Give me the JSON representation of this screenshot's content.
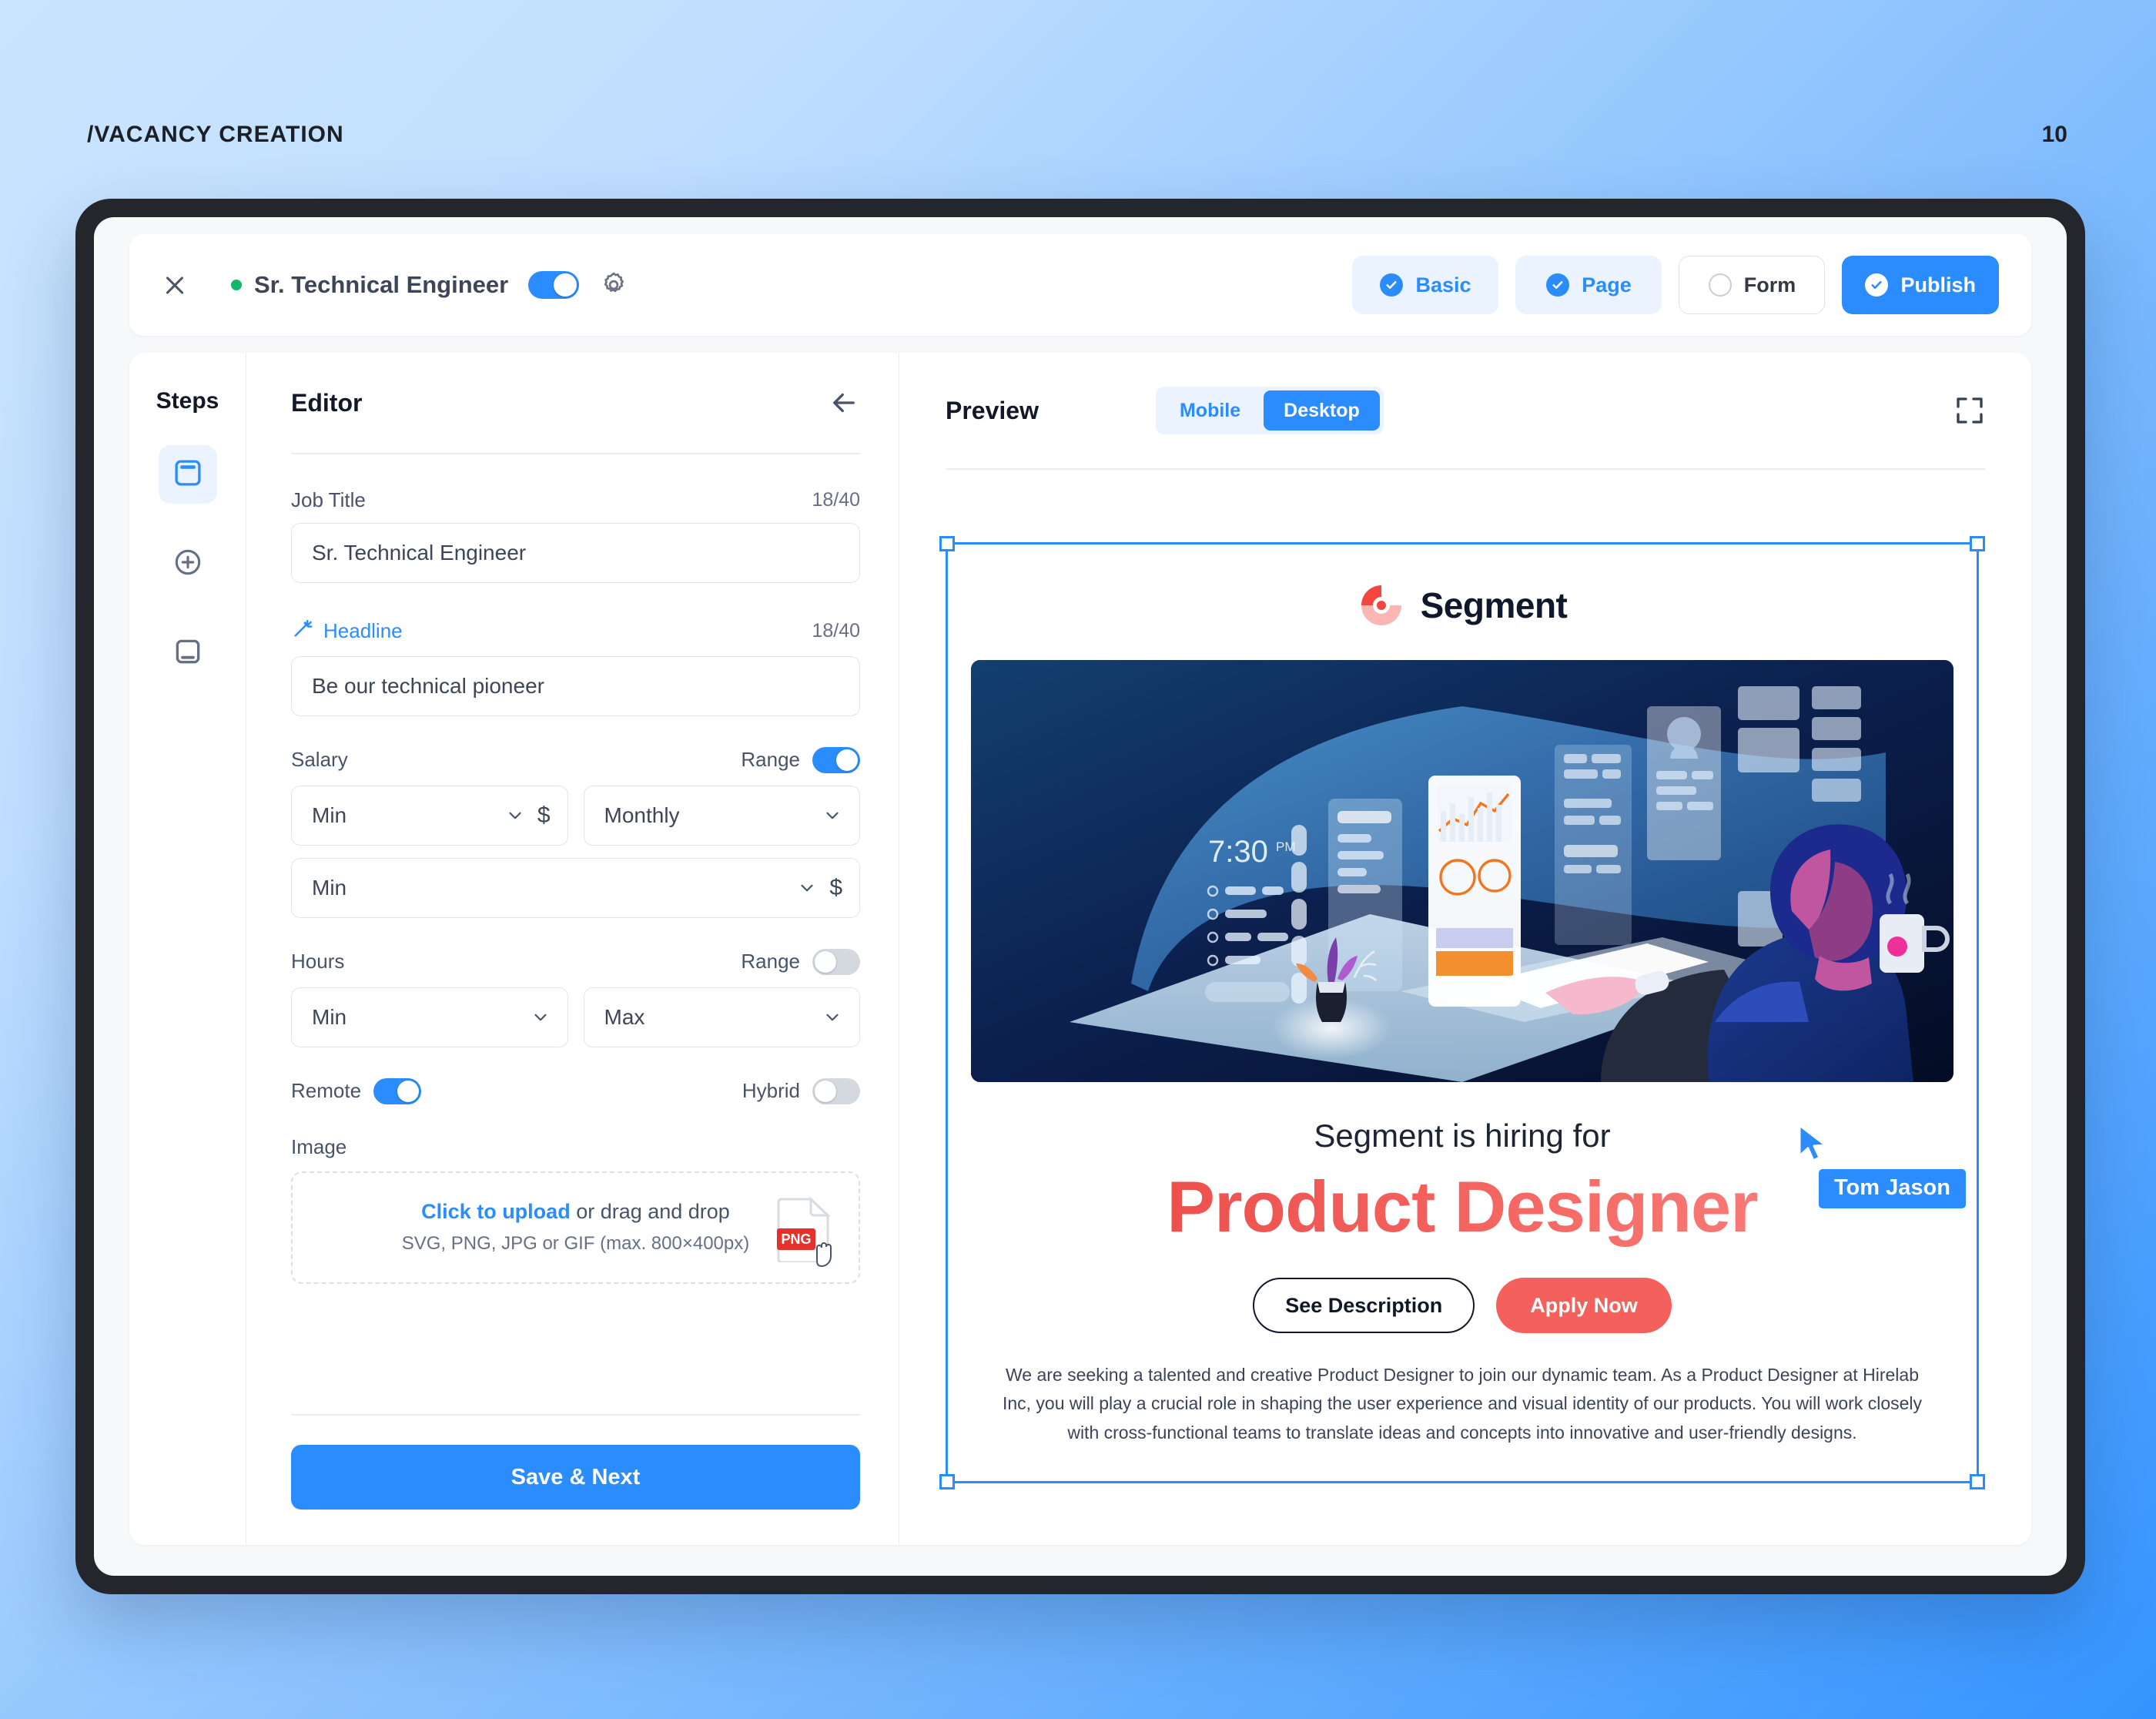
{
  "page": {
    "slug": "/VACANCY CREATION",
    "number": "10"
  },
  "toolbar": {
    "close_icon": "close-icon",
    "status": "active",
    "vacancy_title": "Sr. Technical Engineer",
    "publish_toggle_on": true,
    "settings_icon": "gear-icon",
    "steps": [
      {
        "label": "Basic",
        "state": "done"
      },
      {
        "label": "Page",
        "state": "done"
      },
      {
        "label": "Form",
        "state": "todo"
      },
      {
        "label": "Publish",
        "state": "primary"
      }
    ]
  },
  "steps_rail": {
    "title": "Steps",
    "items": [
      {
        "icon": "header-panel-icon",
        "active": true
      },
      {
        "icon": "plus-circle-icon",
        "active": false
      },
      {
        "icon": "footer-panel-icon",
        "active": false
      }
    ]
  },
  "editor": {
    "title": "Editor",
    "back_icon": "arrow-left-icon",
    "job_title": {
      "label": "Job Title",
      "counter": "18/40",
      "value": "Sr. Technical Engineer"
    },
    "headline": {
      "label": "Headline",
      "icon": "magic-wand-icon",
      "counter": "18/40",
      "value": "Be our technical pioneer"
    },
    "salary": {
      "label": "Salary",
      "range_label": "Range",
      "range_on": true,
      "min_value": "Min",
      "period_value": "Monthly",
      "currency": "$",
      "second_min_value": "Min"
    },
    "hours": {
      "label": "Hours",
      "range_label": "Range",
      "range_on": false,
      "min_value": "Min",
      "max_value": "Max"
    },
    "work_mode": {
      "remote_label": "Remote",
      "remote_on": true,
      "hybrid_label": "Hybrid",
      "hybrid_on": false
    },
    "image": {
      "label": "Image",
      "upload_link": "Click to upload",
      "upload_rest": " or drag and drop",
      "formats": "SVG, PNG, JPG or GIF (max. 800×400px)",
      "file_badge": "PNG"
    },
    "save_label": "Save & Next"
  },
  "preview": {
    "title": "Preview",
    "viewports": [
      {
        "label": "Mobile",
        "active": false
      },
      {
        "label": "Desktop",
        "active": true
      }
    ],
    "expand_icon": "expand-icon",
    "ad": {
      "brand": "Segment",
      "hero_clock": "7:30",
      "hero_clock_suffix": "PM",
      "subheading": "Segment is hiring for",
      "role": "Product Designer",
      "secondary_cta": "See Description",
      "primary_cta": "Apply Now",
      "description": "We are seeking a talented and creative Product Designer to join our dynamic team. As a Product Designer at Hirelab Inc, you will play a crucial role in shaping the user experience and visual identity of our products. You will work closely with cross-functional teams to translate ideas and concepts into innovative and user-friendly designs."
    },
    "collaborator": {
      "name": "Tom Jason",
      "cursor_icon": "pointer-cursor-icon"
    }
  },
  "colors": {
    "accent": "#2b8cfd",
    "accent_soft": "#eaf3ff",
    "brand_red": "#f4605c",
    "status_green": "#12b76a",
    "file_red": "#e8302a"
  }
}
